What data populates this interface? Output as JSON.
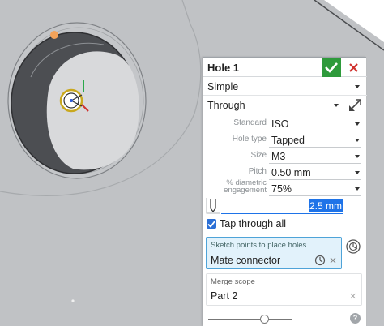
{
  "dialog": {
    "title": "Hole 1",
    "hole_style": "Simple",
    "termination": "Through",
    "standard_label": "Standard",
    "standard_value": "ISO",
    "hole_type_label": "Hole type",
    "hole_type_value": "Tapped",
    "size_label": "Size",
    "size_value": "M3",
    "pitch_label": "Pitch",
    "pitch_value": "0.50 mm",
    "engagement_label_line1": "% diametric",
    "engagement_label_line2": "engagement",
    "engagement_value": "75%",
    "depth_value": "2.5 mm",
    "tap_through_label": "Tap through all",
    "tap_through_checked": true,
    "sketch_points_caption": "Sketch points to place holes",
    "sketch_points_item": "Mate connector",
    "merge_scope_caption": "Merge scope",
    "merge_scope_item": "Part 2",
    "help_label": "?"
  },
  "colors": {
    "accent": "#1e73e8",
    "ok_green": "#2e9a3b",
    "cancel_red": "#d0312d",
    "selection_bg": "#e2f2fb",
    "viewport_bg": "#bfc1c4"
  },
  "icons": {
    "ok": "check-icon",
    "cancel": "close-icon",
    "flip": "flip-direction-icon",
    "mate_connector": "mate-connector-icon",
    "clear": "clear-icon",
    "hole_depth": "hole-depth-icon"
  }
}
